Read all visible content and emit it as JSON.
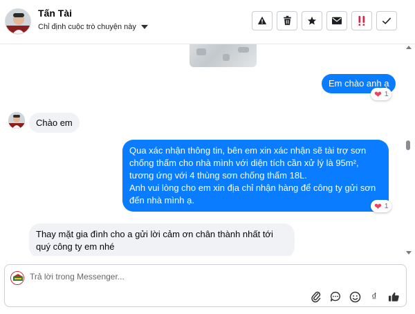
{
  "header": {
    "contact_name": "Tấn Tài",
    "assign_label": "Chỉ định cuộc trò chuyện này",
    "actions": [
      {
        "icon": "warning-icon"
      },
      {
        "icon": "trash-icon"
      },
      {
        "icon": "star-icon"
      },
      {
        "icon": "envelope-icon"
      },
      {
        "icon": "double-exclamation-icon"
      },
      {
        "icon": "check-icon"
      }
    ]
  },
  "messages": {
    "m1": {
      "text": "Em chào anh ạ",
      "reaction_count": "1"
    },
    "m2": {
      "text": "Chào em"
    },
    "m3": {
      "text": "Qua xác nhận thông tin, bên em xin xác nhận sẽ tài trợ sơn chống thấm cho nhà mình với diện tích cần xử lý là 95m², tương ứng với 4 thùng sơn chống thấm 18L.\nAnh vui lòng cho em xin địa chỉ nhận hàng để công ty gửi sơn đến nhà mình ạ.",
      "reaction_count": "1"
    },
    "m4": {
      "text": "Thay mặt gia đình cho a  gửi lời cảm ơn chân thành nhất tới quý công ty em nhé"
    }
  },
  "composer": {
    "placeholder": "Trả lời trong Messenger...",
    "tools": [
      "paperclip-icon",
      "chat-bubble-icon",
      "emoji-icon",
      "dong-icon",
      "thumbs-up-icon"
    ],
    "currency_symbol": "₫"
  },
  "colors": {
    "outgoing_bubble": "#0a7cff",
    "incoming_bubble": "#f0f2f5",
    "reaction_heart": "#f33e58",
    "alert_red": "#e41e3f"
  }
}
